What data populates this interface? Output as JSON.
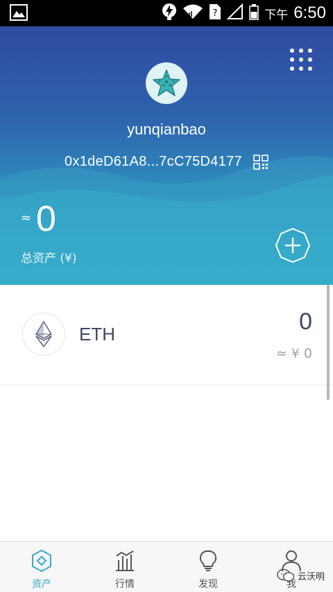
{
  "status_bar": {
    "time_prefix": "下午",
    "time": "6:50",
    "icons": [
      "gallery-icon",
      "bolt-icon",
      "wifi-icon",
      "sim-icon",
      "signal-icon",
      "battery-icon"
    ]
  },
  "header": {
    "menu_icon": "grid-menu-icon",
    "avatar_icon": "starfish-icon",
    "wallet_name": "yunqianbao",
    "address": "0x1deD61A8...7cC75D4177",
    "approx_symbol": "≈",
    "total_value": "0",
    "total_label": "总资产 (¥)",
    "add_icon": "plus-icon"
  },
  "assets": [
    {
      "name": "ETH",
      "amount": "0",
      "fiat": "≈ ¥ 0",
      "icon": "ethereum-icon"
    }
  ],
  "nav": {
    "items": [
      {
        "label": "资产",
        "icon": "assets-diamond-icon",
        "active": true
      },
      {
        "label": "行情",
        "icon": "market-chart-icon",
        "active": false
      },
      {
        "label": "发现",
        "icon": "discover-bulb-icon",
        "active": false
      },
      {
        "label": "我",
        "icon": "profile-person-icon",
        "active": false
      }
    ]
  },
  "watermark": {
    "text": "云沃明"
  },
  "colors": {
    "header_top": "#2f4aa2",
    "header_bottom": "#34b6c9",
    "accent": "#33a9c9",
    "text_dark": "#3c4a5c",
    "text_muted": "#9aa3ad"
  }
}
